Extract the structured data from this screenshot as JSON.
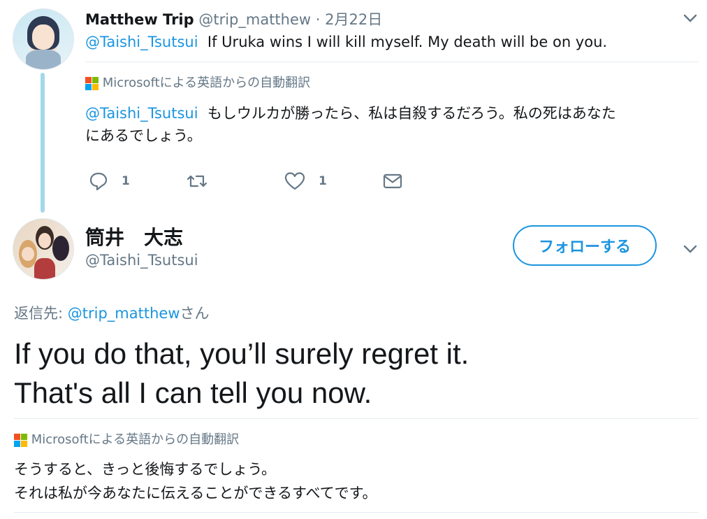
{
  "tweet1": {
    "display_name": "Matthew Trip",
    "handle": "@trip_matthew",
    "date": "· 2月22日",
    "mention": "@Taishi_Tsutsui",
    "text": "If Uruka wins I will kill myself. My death will be on you.",
    "translation_label": "Microsoftによる英語からの自動翻訳",
    "translation_mention": "@Taishi_Tsutsui",
    "translation_text_1": "もしウルカが勝ったら、私は自殺するだろう。私の死はあなた",
    "translation_text_2": "にあるでしょう。",
    "reply_count": "1",
    "like_count": "1"
  },
  "tweet2": {
    "display_name": "筒井　大志",
    "handle": "@Taishi_Tsutsui",
    "follow_label": "フォローする",
    "reply_prefix": "返信先: ",
    "reply_to": "@trip_matthew",
    "reply_suffix": "さん",
    "text_line1": "If you do that, you’ll surely regret it.",
    "text_line2": "That's all I can tell you now.",
    "translation_label": "Microsoftによる英語からの自動翻訳",
    "translation_line1": "そうすると、きっと後悔するでしょう。",
    "translation_line2": "それは私が今あなたに伝えることができるすべてです。"
  },
  "colors": {
    "accent": "#1b95e0",
    "muted": "#657786",
    "thread_line": "#a3d8ea",
    "ms_red": "#f25022",
    "ms_green": "#7fba00",
    "ms_blue": "#00a4ef",
    "ms_yellow": "#ffb900"
  },
  "icons": [
    "reply-icon",
    "retweet-icon",
    "like-icon",
    "dm-icon",
    "chevron-down-icon",
    "microsoft-logo-icon"
  ]
}
